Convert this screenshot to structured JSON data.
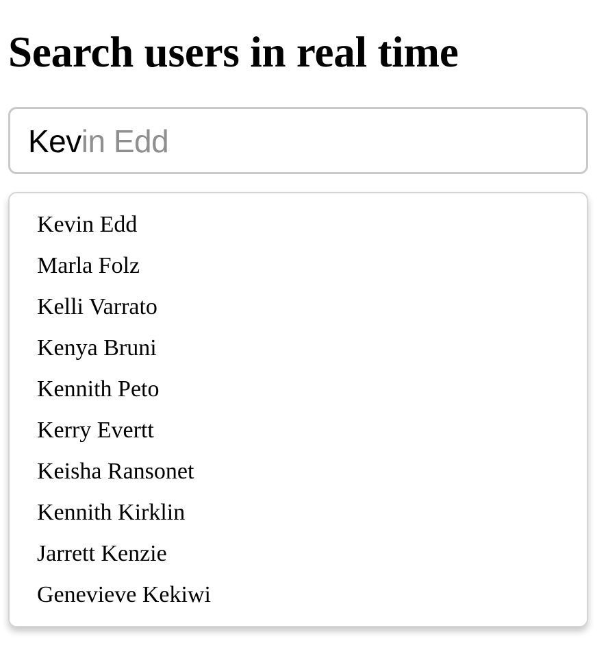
{
  "header": {
    "title": "Search users in real time"
  },
  "search": {
    "typed_text": "Kev",
    "suggestion_text": "in Edd",
    "value": "Kev"
  },
  "results": [
    {
      "name": "Kevin Edd"
    },
    {
      "name": "Marla Folz"
    },
    {
      "name": "Kelli Varrato"
    },
    {
      "name": "Kenya Bruni"
    },
    {
      "name": "Kennith Peto"
    },
    {
      "name": "Kerry Evertt"
    },
    {
      "name": "Keisha Ransonet"
    },
    {
      "name": "Kennith Kirklin"
    },
    {
      "name": "Jarrett Kenzie"
    },
    {
      "name": "Genevieve Kekiwi"
    }
  ],
  "colors": {
    "typed_text": "#000000",
    "suggestion_text": "#8f8f8f",
    "border": "#c9c9c9",
    "background": "#ffffff"
  }
}
